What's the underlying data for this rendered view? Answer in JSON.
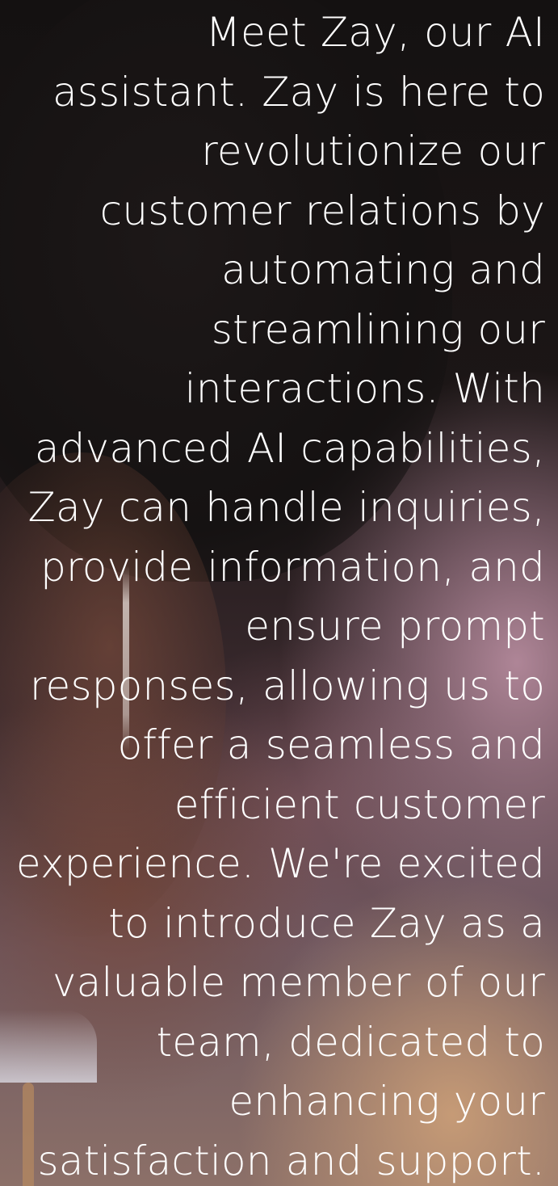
{
  "announcement": {
    "lines": [
      "Meet Zay, our AI",
      "assistant. Zay is here to",
      "revolutionize our",
      "customer relations by",
      "automating and",
      "streamlining our",
      "interactions. With",
      "advanced AI capabilities,",
      "Zay can handle inquiries,",
      "provide information, and",
      "ensure prompt",
      "responses, allowing us to",
      "offer a seamless and",
      "efficient customer",
      "experience. We're excited",
      "to introduce Zay as a",
      "valuable member of our",
      "team, dedicated to",
      "enhancing your",
      "satisfaction and support."
    ]
  },
  "colors": {
    "text": "#ffffff",
    "background_dark": "#141111",
    "background_warm": "#c496aa"
  }
}
